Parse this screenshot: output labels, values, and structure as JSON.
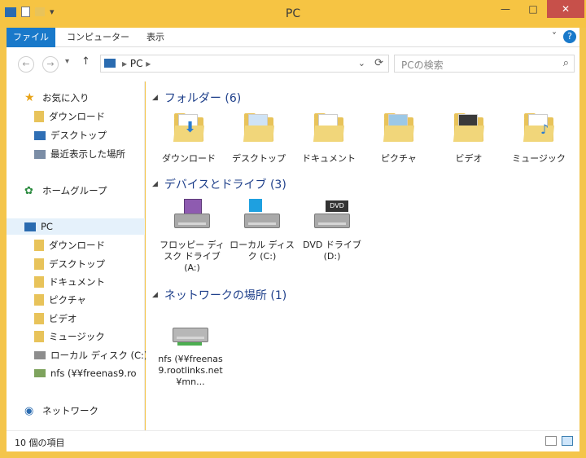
{
  "window": {
    "title": "PC",
    "controls": {
      "minimize": "—",
      "maximize": "□",
      "close": "✕"
    },
    "qat": {
      "dropdown": "▾"
    }
  },
  "ribbon": {
    "tabs": [
      "ファイル",
      "コンピューター",
      "表示"
    ],
    "expand": "˅",
    "help": "?"
  },
  "address": {
    "back": "←",
    "forward": "→",
    "recent": "▾",
    "up": "↑",
    "path": "PC",
    "refresh": "⟳",
    "search_placeholder": "PCの検索",
    "search_icon": "⌕"
  },
  "nav": {
    "favorites_label": "お気に入り",
    "favorites": [
      "ダウンロード",
      "デスクトップ",
      "最近表示した場所"
    ],
    "homegroup_label": "ホームグループ",
    "pc_label": "PC",
    "pc_items": [
      "ダウンロード",
      "デスクトップ",
      "ドキュメント",
      "ピクチャ",
      "ビデオ",
      "ミュージック",
      "ローカル ディスク (C:)",
      "nfs (¥¥freenas9.ro"
    ],
    "network_label": "ネットワーク"
  },
  "content": {
    "folders_header": "フォルダー (6)",
    "folders": [
      "ダウンロード",
      "デスクトップ",
      "ドキュメント",
      "ピクチャ",
      "ビデオ",
      "ミュージック"
    ],
    "devices_header": "デバイスとドライブ (3)",
    "devices": [
      "フロッピー ディスク ドライブ (A:)",
      "ローカル ディスク (C:)",
      "DVD ドライブ (D:)"
    ],
    "network_header": "ネットワークの場所 (1)",
    "network_items": [
      "nfs (¥¥freenas9.rootlinks.net¥mn..."
    ]
  },
  "status": {
    "count": "10 個の項目"
  }
}
